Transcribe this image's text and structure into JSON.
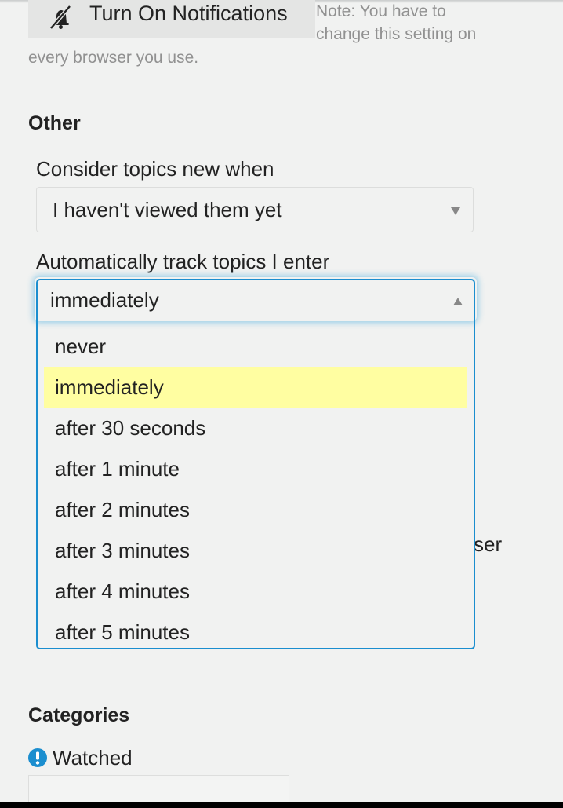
{
  "notifications": {
    "button_label": "Turn On Notifications",
    "button_icon": "bell-slash-icon",
    "note_line1": "Note: You have to",
    "note_line2": "change this setting on",
    "note_line3": "every browser you use."
  },
  "other_section": {
    "heading": "Other",
    "new_topics": {
      "label": "Consider topics new when",
      "selected": "I haven't viewed them yet",
      "caret_icon": "chevron-down-icon"
    },
    "auto_track": {
      "label": "Automatically track topics I enter",
      "selected": "immediately",
      "caret_icon": "chevron-up-icon",
      "options": [
        "never",
        "immediately",
        "after 30 seconds",
        "after 1 minute",
        "after 2 minutes",
        "after 3 minutes",
        "after 4 minutes",
        "after 5 minutes"
      ],
      "highlighted_option": "immediately"
    },
    "obscured_text_fragment": "ser"
  },
  "categories_section": {
    "heading": "Categories",
    "watched_label": "Watched",
    "watched_icon": "exclamation-circle-icon"
  },
  "colors": {
    "background": "#f1f2f1",
    "focus_border": "#1b8ecf",
    "highlight": "#fffea1",
    "note_text": "#919191",
    "watched_icon": "#1b8ecf"
  }
}
